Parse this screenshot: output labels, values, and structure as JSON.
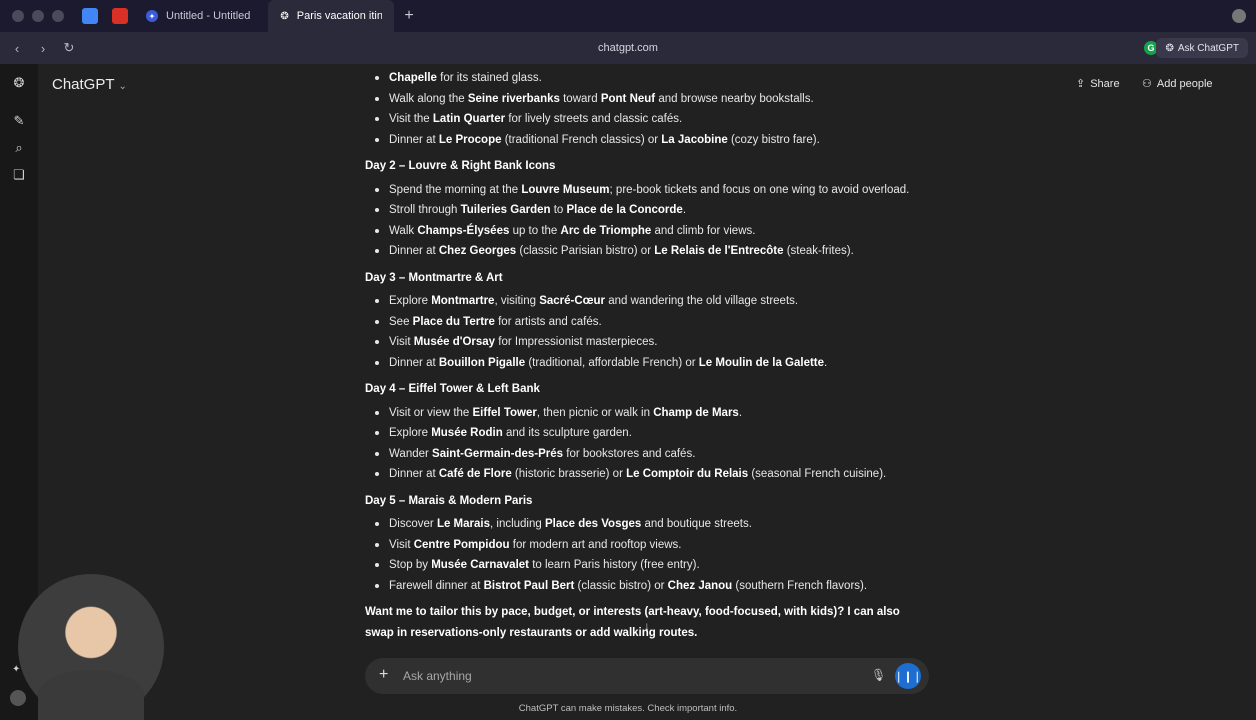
{
  "browser": {
    "tabs": [
      {
        "label": "Untitled - Untitled"
      },
      {
        "label": "Paris vacation itinera"
      }
    ],
    "url": "chatgpt.com",
    "ask_button": "Ask ChatGPT"
  },
  "header": {
    "title": "ChatGPT",
    "share": "Share",
    "add_people": "Add people"
  },
  "chat": {
    "intro_line1_bold": "Chapelle",
    "intro_line1_rest": " for its stained glass.",
    "day1_items": [
      [
        "Walk along the ",
        "Seine riverbanks",
        " toward ",
        "Pont Neuf",
        " and browse nearby bookstalls."
      ],
      [
        "Visit the ",
        "Latin Quarter",
        " for lively streets and classic cafés."
      ],
      [
        "Dinner at ",
        "Le Procope",
        " (traditional French classics) or ",
        "La Jacobine",
        " (cozy bistro fare)."
      ]
    ],
    "days": [
      {
        "title": "Day 2 – Louvre & Right Bank Icons",
        "items": [
          [
            "Spend the morning at the ",
            "Louvre Museum",
            "; pre-book tickets and focus on one wing to avoid overload."
          ],
          [
            "Stroll through ",
            "Tuileries Garden",
            " to ",
            "Place de la Concorde",
            "."
          ],
          [
            "Walk ",
            "Champs-Élysées",
            " up to the ",
            "Arc de Triomphe",
            " and climb for views."
          ],
          [
            "Dinner at ",
            "Chez Georges",
            " (classic Parisian bistro) or ",
            "Le Relais de l'Entrecôte",
            " (steak-frites)."
          ]
        ]
      },
      {
        "title": "Day 3 – Montmartre & Art",
        "items": [
          [
            "Explore ",
            "Montmartre",
            ", visiting ",
            "Sacré-Cœur",
            " and wandering the old village streets."
          ],
          [
            "See ",
            "Place du Tertre",
            " for artists and cafés."
          ],
          [
            "Visit ",
            "Musée d'Orsay",
            " for Impressionist masterpieces."
          ],
          [
            "Dinner at ",
            "Bouillon Pigalle",
            " (traditional, affordable French) or ",
            "Le Moulin de la Galette",
            "."
          ]
        ]
      },
      {
        "title": "Day 4 – Eiffel Tower & Left Bank",
        "items": [
          [
            "Visit or view the ",
            "Eiffel Tower",
            ", then picnic or walk in ",
            "Champ de Mars",
            "."
          ],
          [
            "Explore ",
            "Musée Rodin",
            " and its sculpture garden."
          ],
          [
            "Wander ",
            "Saint-Germain-des-Prés",
            " for bookstores and cafés."
          ],
          [
            "Dinner at ",
            "Café de Flore",
            " (historic brasserie) or ",
            "Le Comptoir du Relais",
            " (seasonal French cuisine)."
          ]
        ]
      },
      {
        "title": "Day 5 – Marais & Modern Paris",
        "items": [
          [
            "Discover ",
            "Le Marais",
            ", including ",
            "Place des Vosges",
            " and boutique streets."
          ],
          [
            "Visit ",
            "Centre Pompidou",
            " for modern art and rooftop views."
          ],
          [
            "Stop by ",
            "Musée Carnavalet",
            " to learn Paris history (free entry)."
          ],
          [
            "Farewell dinner at ",
            "Bistrot Paul Bert",
            " (classic bistro) or ",
            "Chez Janou",
            " (southern French flavors)."
          ]
        ]
      }
    ],
    "closing": "Want me to tailor this by pace, budget, or interests (art-heavy, food-focused, with kids)? I can also swap in reservations-only restaurants or add walking routes."
  },
  "composer": {
    "placeholder": "Ask anything"
  },
  "footer": {
    "disclaimer": "ChatGPT can make mistakes. Check important info."
  }
}
